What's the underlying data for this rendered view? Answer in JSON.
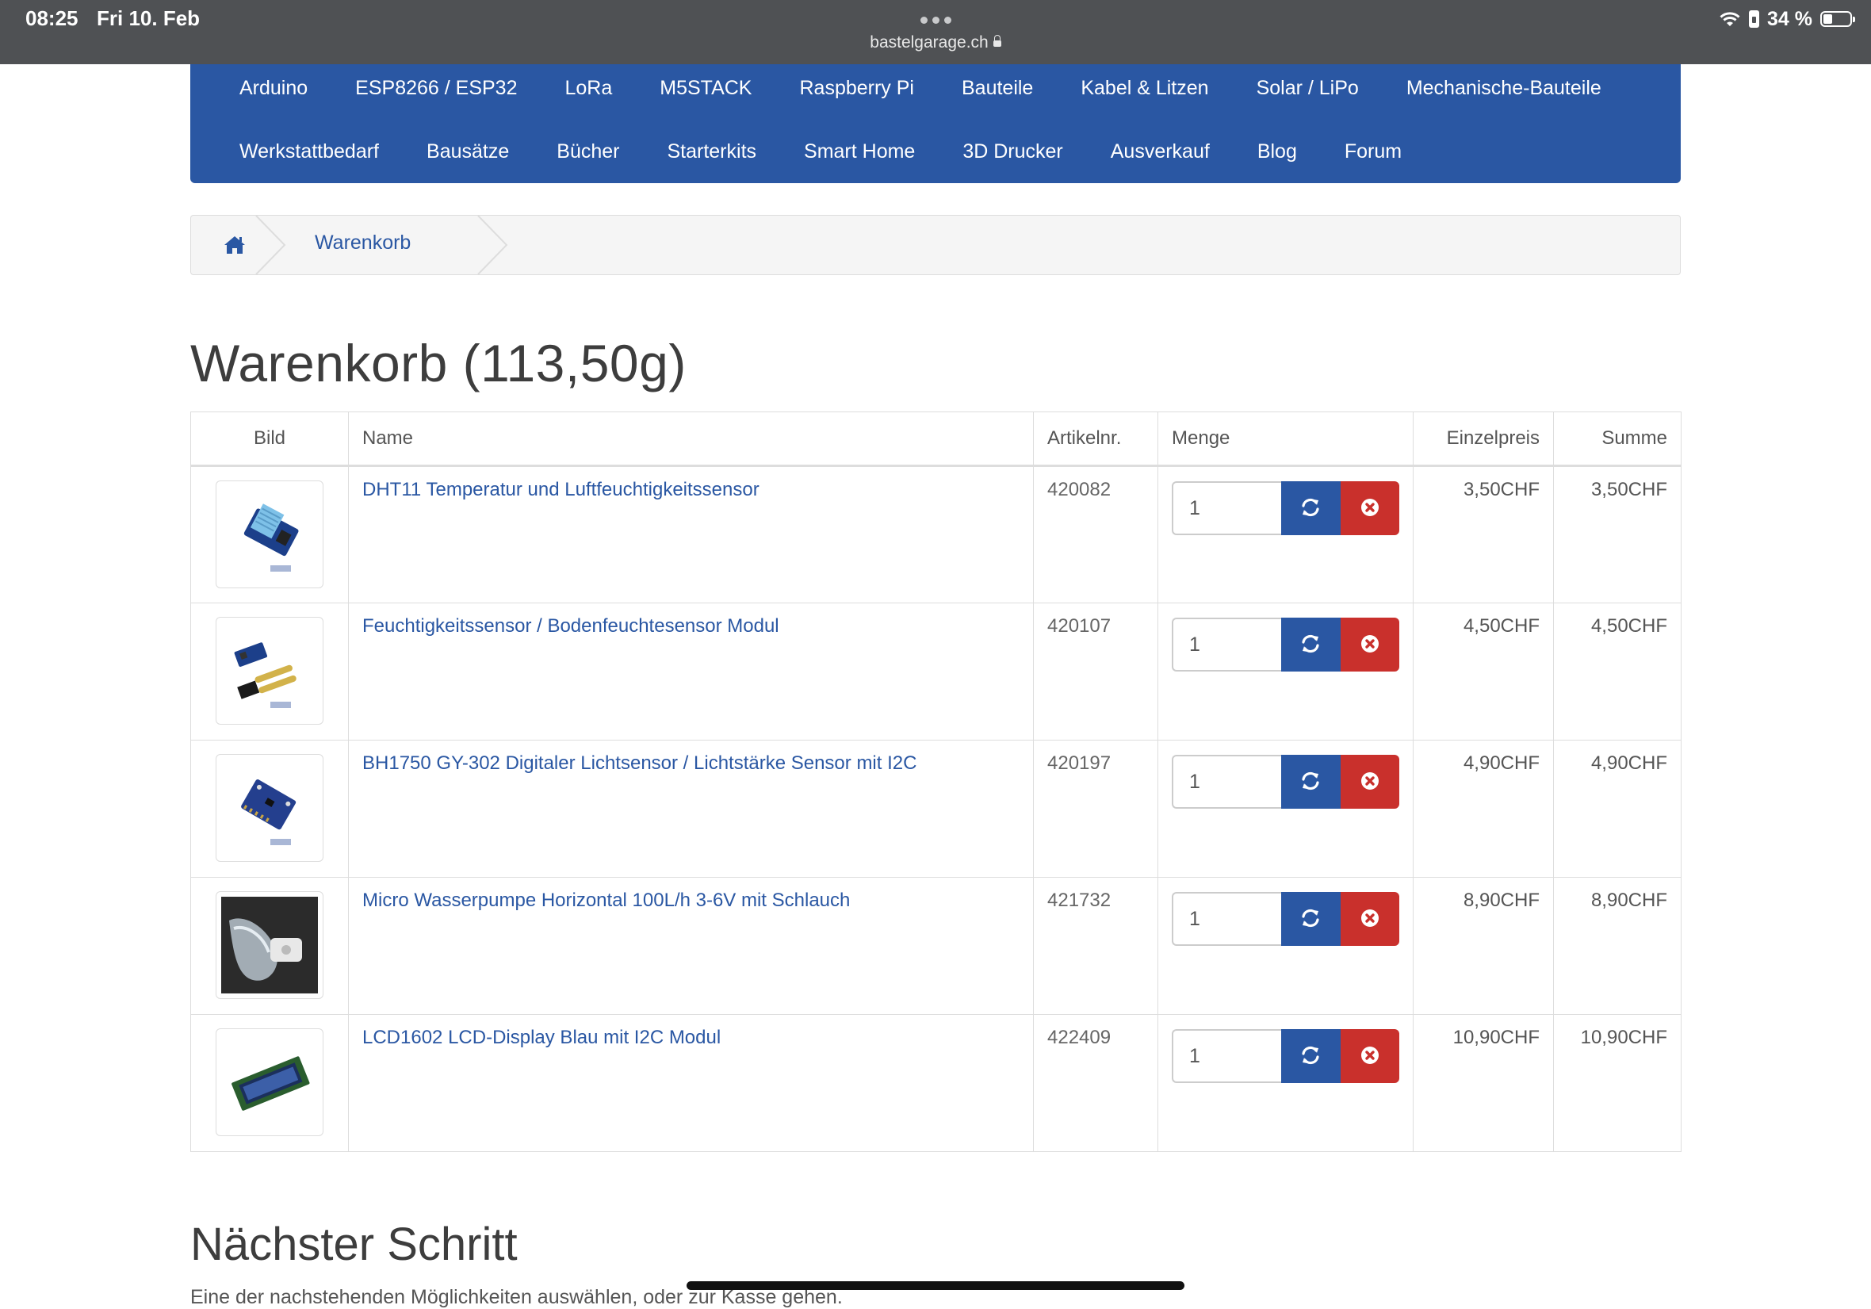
{
  "status_bar": {
    "time": "08:25",
    "date": "Fri 10. Feb",
    "url": "bastelgarage.ch",
    "battery": "34 %",
    "battery_level": 0.34
  },
  "nav": {
    "row1": [
      "Arduino",
      "ESP8266 / ESP32",
      "LoRa",
      "M5STACK",
      "Raspberry Pi",
      "Bauteile",
      "Kabel & Litzen",
      "Solar / LiPo",
      "Mechanische-Bauteile"
    ],
    "row2": [
      "Werkstattbedarf",
      "Bausätze",
      "Bücher",
      "Starterkits",
      "Smart Home",
      "3D Drucker",
      "Ausverkauf",
      "Blog",
      "Forum"
    ]
  },
  "breadcrumb": {
    "home_icon": "home-icon",
    "current": "Warenkorb"
  },
  "page": {
    "title": "Warenkorb  (113,50g)"
  },
  "table": {
    "headers": {
      "bild": "Bild",
      "name": "Name",
      "artikelnr": "Artikelnr.",
      "menge": "Menge",
      "einzelpreis": "Einzelpreis",
      "summe": "Summe"
    },
    "rows": [
      {
        "name": "DHT11 Temperatur und Luftfeuchtigkeitssensor",
        "artikelnr": "420082",
        "qty": "1",
        "einzelpreis": "3,50CHF",
        "summe": "3,50CHF",
        "image": "dht11-sensor"
      },
      {
        "name": "Feuchtigkeitssensor / Bodenfeuchtesensor Modul",
        "artikelnr": "420107",
        "qty": "1",
        "einzelpreis": "4,50CHF",
        "summe": "4,50CHF",
        "image": "soil-moisture-sensor"
      },
      {
        "name": "BH1750 GY-302 Digitaler Lichtsensor / Lichtstärke Sensor mit I2C",
        "artikelnr": "420197",
        "qty": "1",
        "einzelpreis": "4,90CHF",
        "summe": "4,90CHF",
        "image": "light-sensor-board"
      },
      {
        "name": "Micro Wasserpumpe Horizontal 100L/h 3-6V mit Schlauch",
        "artikelnr": "421732",
        "qty": "1",
        "einzelpreis": "8,90CHF",
        "summe": "8,90CHF",
        "image": "water-pump"
      },
      {
        "name": "LCD1602 LCD-Display Blau mit I2C Modul",
        "artikelnr": "422409",
        "qty": "1",
        "einzelpreis": "10,90CHF",
        "summe": "10,90CHF",
        "image": "lcd-display"
      }
    ]
  },
  "next_step": {
    "title": "Nächster Schritt",
    "subtitle": "Eine der nachstehenden Möglichkeiten auswählen, oder zur Kasse gehen."
  },
  "colors": {
    "brand_blue": "#2a57a3",
    "danger_red": "#c9302c",
    "status_bar": "#4f5154"
  },
  "icons": {
    "refresh": "refresh-icon",
    "remove": "remove-icon",
    "wifi": "wifi-icon",
    "battery": "battery-icon"
  }
}
